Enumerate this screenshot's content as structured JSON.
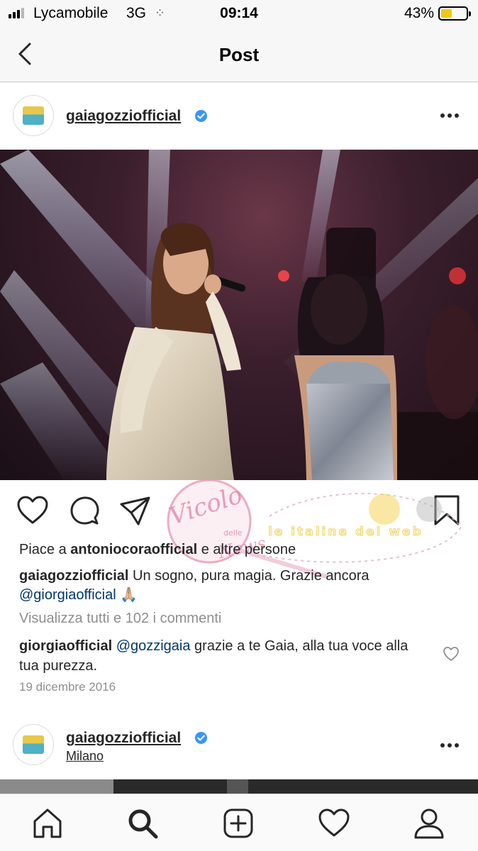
{
  "status_bar": {
    "carrier": "Lycamobile",
    "network": "3G",
    "time": "09:14",
    "battery_percent": "43%",
    "battery_level": 0.43,
    "battery_color": "#f5c518"
  },
  "nav": {
    "title": "Post",
    "back_icon": "chevron-left-icon"
  },
  "post": {
    "username": "gaiagozziofficial",
    "verified_icon": "verified-badge-icon",
    "more_icon": "more-horizontal-icon",
    "actions": [
      "heart-icon",
      "comment-icon",
      "share-icon",
      "bookmark-icon"
    ],
    "likes": {
      "prefix": "Piace a ",
      "user": "antoniocoraofficial",
      "suffix": " e altre persone"
    },
    "caption": {
      "username": "gaiagozziofficial",
      "text": " Un sogno, pura magia. Grazie ancora ",
      "mention": "@giorgiaofficial",
      "emoji": " 🙏🏼"
    },
    "view_comments": "Visualizza tutti e 102 i commenti",
    "comment": {
      "username": "giorgiaofficial",
      "mention": "@gozzigaia",
      "text": " grazie a te Gaia, alla tua voce alla tua purezza."
    },
    "date": "19 dicembre 2016"
  },
  "watermark": {
    "title": "Vicolo",
    "sub1": "delle",
    "sub2": "News",
    "tagline": "le italine del web"
  },
  "next_post": {
    "username": "gaiagozziofficial",
    "location": "Milano"
  },
  "tab_bar": {
    "items": [
      "home-icon",
      "search-icon",
      "add-post-icon",
      "activity-heart-icon",
      "profile-icon"
    ]
  }
}
